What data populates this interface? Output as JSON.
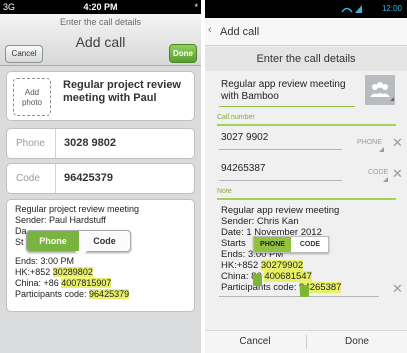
{
  "ios": {
    "status": {
      "carrier": "3G",
      "time": "4:20 PM",
      "battery": "*"
    },
    "nav": {
      "subtitle": "Enter the call details",
      "title": "Add call",
      "cancel": "Cancel",
      "done": "Done"
    },
    "add_photo": [
      "Add",
      "photo"
    ],
    "subject": "Regular project review meeting with Paul",
    "fields": [
      {
        "label": "Phone",
        "value": "3028 9802"
      },
      {
        "label": "Code",
        "value": "96425379"
      }
    ],
    "note": {
      "line1": "Regular project review meeting",
      "line2": "Sender: Paul Hardstuff",
      "line3": "Da",
      "line4": "St",
      "line5": "Ends: 3:00 PM",
      "line6_pre": "HK:+852 ",
      "line6_hl": "30289802",
      "line7_pre": "China: +86 ",
      "line7_hl": "4007815907",
      "line8_pre": "Participants code: ",
      "line8_hl": "96425379"
    },
    "popup": {
      "left": "Phone",
      "right": "Code"
    }
  },
  "android": {
    "status": {
      "time": "12:00"
    },
    "action_bar_title": "Add call",
    "header": "Enter the call details",
    "subject": "Regular app review meeting with Bamboo",
    "call_number_label": "Call number",
    "number_rows": [
      {
        "value": "3027 9902",
        "type": "PHONE"
      },
      {
        "value": "94265387",
        "type": "CODE"
      }
    ],
    "note_label": "Note",
    "note": {
      "line1": "Regular app review meeting",
      "line2": "Sender: Chris Kan",
      "line3": "Date: 1 November 2012",
      "line4": "Starts",
      "line5": "Ends: 3:00 PM",
      "line6_pre": "HK:+852 ",
      "line6_hl": "30279902",
      "line7_pre": "China: ",
      "line7_mid": "86 ",
      "line7_hl": "400681547",
      "line8_pre": "Participants code: ",
      "line8_hl": "94265387"
    },
    "popup": {
      "left": "PHONE",
      "right": "CODE"
    },
    "bottom": {
      "cancel": "Cancel",
      "done": "Done"
    }
  },
  "colors": {
    "ios_green": "#79b440",
    "android_green": "#92c33f",
    "highlight": "#e8f06a",
    "android_accent": "#33b5e5"
  }
}
